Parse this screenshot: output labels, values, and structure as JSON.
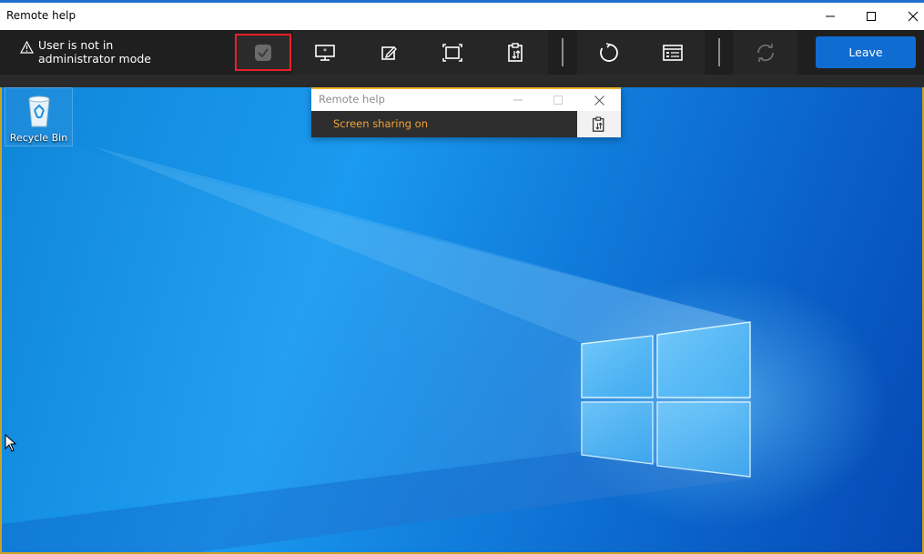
{
  "window": {
    "title": "Remote help",
    "controls": [
      "minimize-icon",
      "maximize-icon",
      "close-icon"
    ]
  },
  "toolbar": {
    "warning_line1": "User is not in",
    "warning_line2": "administrator mode",
    "buttons": [
      {
        "icon": "elevate-shield-icon",
        "state": "selected-disabled"
      },
      {
        "icon": "monitor-icon"
      },
      {
        "icon": "annotate-pen-icon"
      },
      {
        "icon": "fit-screen-icon"
      },
      {
        "icon": "clipboard-transfer-icon"
      },
      {
        "icon": "restart-icon"
      },
      {
        "icon": "task-manager-icon"
      },
      {
        "icon": "reconnect-icon",
        "state": "disabled"
      }
    ],
    "leave_label": "Leave"
  },
  "desktop": {
    "recycle_bin_label": "Recycle Bin"
  },
  "popup": {
    "title": "Remote help",
    "status": "Screen sharing on"
  },
  "colors": {
    "accent": "#0f6cd0",
    "toolbar_bg": "#1f1f1f",
    "selected_outline": "#e8202a",
    "status_text": "#f2a33a",
    "session_border": "#c9a227"
  }
}
